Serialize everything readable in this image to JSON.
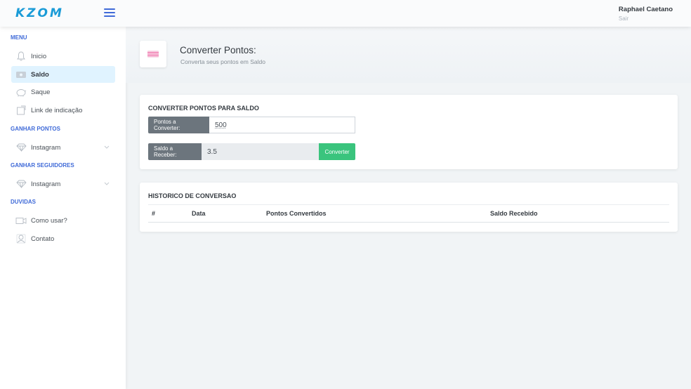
{
  "header": {
    "logo": "KZOM",
    "user_name": "Raphael Caetano",
    "logout": "Sair"
  },
  "sidebar": {
    "sections": [
      {
        "title": "MENU"
      },
      {
        "title": "GANHAR PONTOS"
      },
      {
        "title": "GANHAR SEGUIDORES"
      },
      {
        "title": "DUVIDAS"
      }
    ],
    "items": [
      {
        "label": "Inicio",
        "icon": "bell-icon"
      },
      {
        "label": "Saldo",
        "icon": "wallet-icon",
        "active": true
      },
      {
        "label": "Saque",
        "icon": "piggy-bank-icon"
      },
      {
        "label": "Link de indicação",
        "icon": "share-icon"
      },
      {
        "label": "Instagram",
        "icon": "diamond-icon"
      },
      {
        "label": "Instagram",
        "icon": "diamond-icon"
      },
      {
        "label": "Como usar?",
        "icon": "video-camera-icon"
      },
      {
        "label": "Contato",
        "icon": "user-contact-icon"
      }
    ]
  },
  "page": {
    "title": "Converter Pontos:",
    "subtitle": "Converta seus pontos em Saldo",
    "icon": "cash-icon"
  },
  "convert_card": {
    "title": "CONVERTER PONTOS PARA SALDO",
    "points_label": "Pontos a Converter:",
    "points_value": "500",
    "balance_label": "Saldo a Receber:",
    "balance_value": "3.5",
    "convert_button": "Converter"
  },
  "history_card": {
    "title": "HISTORICO DE CONVERSAO",
    "columns": [
      "#",
      "Data",
      "Pontos Convertidos",
      "Saldo Recebido"
    ]
  },
  "colors": {
    "accent": "#3f6ad8",
    "logo": "#1a9bd7",
    "success": "#3ac47d",
    "active_item_bg": "#e0f3ff"
  }
}
